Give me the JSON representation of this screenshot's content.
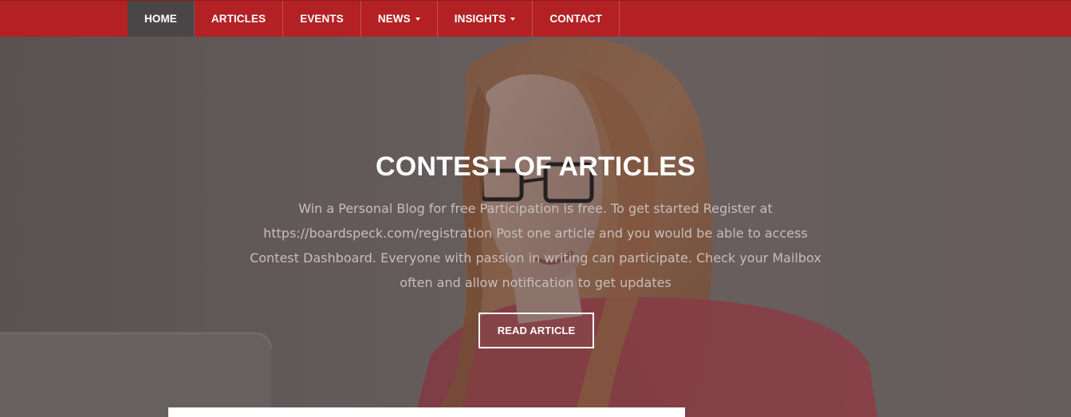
{
  "nav": {
    "items": [
      {
        "label": "HOME",
        "active": true,
        "dropdown": false
      },
      {
        "label": "ARTICLES",
        "active": false,
        "dropdown": false
      },
      {
        "label": "EVENTS",
        "active": false,
        "dropdown": false
      },
      {
        "label": "NEWS",
        "active": false,
        "dropdown": true
      },
      {
        "label": "INSIGHTS",
        "active": false,
        "dropdown": true
      },
      {
        "label": "CONTACT",
        "active": false,
        "dropdown": false
      }
    ]
  },
  "hero": {
    "title": "CONTEST OF ARTICLES",
    "description": "Win a Personal Blog for free Participation is free. To get started Register at https://boardspeck.com/registration Post one article and you would be able to access Contest Dashboard. Everyone with passion in writing can participate. Check your Mailbox often and allow notification to get updates",
    "button_label": "READ ARTICLE"
  },
  "colors": {
    "nav_background": "#b32124",
    "nav_active_background": "#4a4647",
    "hero_text": "#c8bdbb",
    "button_border": "#ffffff"
  },
  "icons": {
    "dropdown": "chevron-down-icon"
  }
}
